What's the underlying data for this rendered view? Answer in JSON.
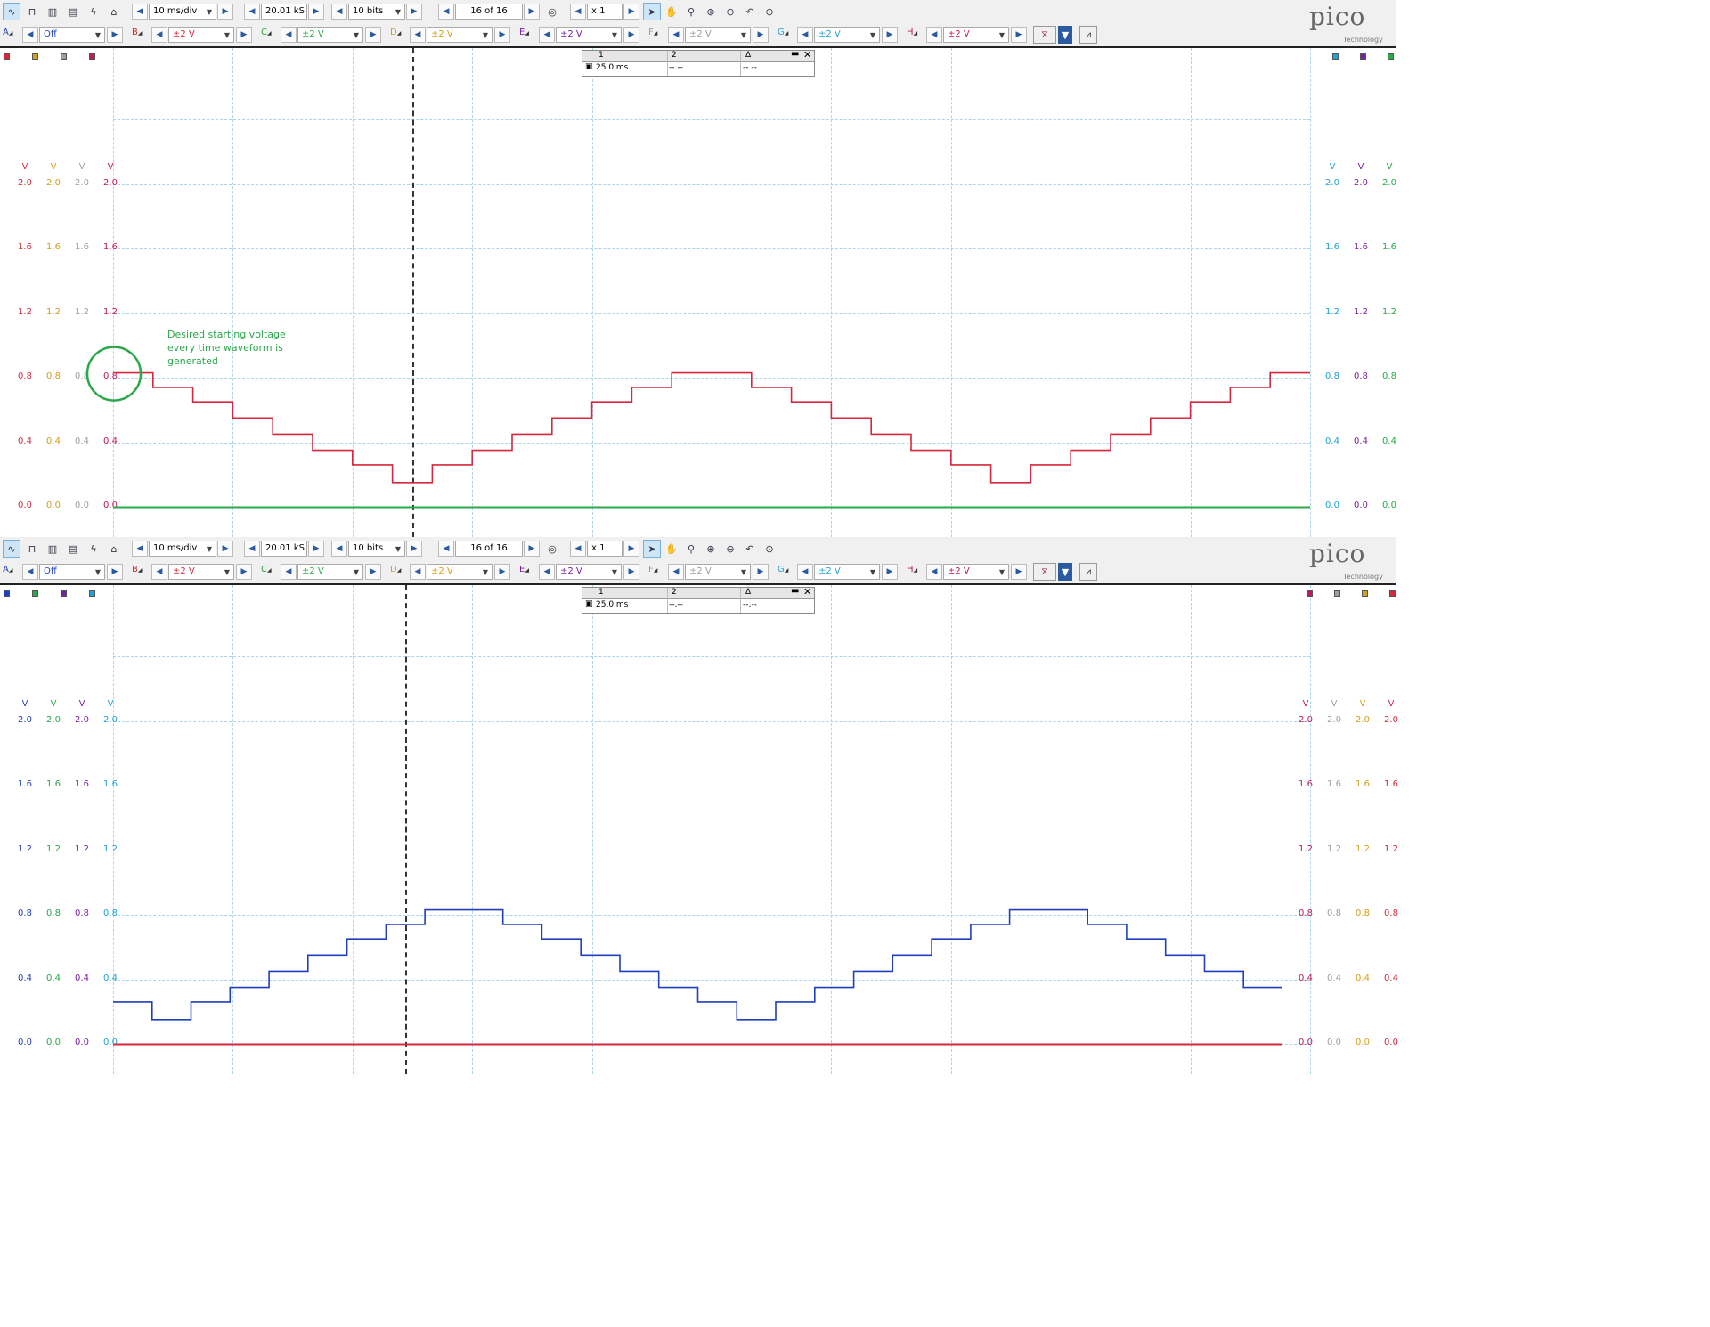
{
  "panels": [
    {
      "id": "top",
      "toolbar": {
        "timebase": "10 ms/div",
        "samples": "20.01 kS",
        "resolution": "10 bits",
        "buffer": "16 of 16",
        "zoom": "x 1"
      },
      "channels": [
        {
          "letter": "A",
          "range": "Off",
          "color": "#1f3fbf"
        },
        {
          "letter": "B",
          "range": "±2 V",
          "color": "#d6283c"
        },
        {
          "letter": "C",
          "range": "±2 V",
          "color": "#2aa84a"
        },
        {
          "letter": "D",
          "range": "±2 V",
          "color": "#d4a017"
        },
        {
          "letter": "E",
          "range": "±2 V",
          "color": "#7b1fa2"
        },
        {
          "letter": "F",
          "range": "±2 V",
          "color": "#9e9e9e"
        },
        {
          "letter": "G",
          "range": "±2 V",
          "color": "#1fa2d6"
        },
        {
          "letter": "H",
          "range": "±2 V",
          "color": "#c2185b"
        }
      ],
      "left_axes": [
        {
          "unit": "V",
          "color": "#d6283c",
          "ticks": [
            "2.0",
            "1.6",
            "1.2",
            "0.8",
            "0.4",
            "0.0"
          ]
        },
        {
          "unit": "V",
          "color": "#d4a017",
          "ticks": [
            "2.0",
            "1.6",
            "1.2",
            "0.8",
            "0.4",
            "0.0"
          ]
        },
        {
          "unit": "V",
          "color": "#9e9e9e",
          "ticks": [
            "2.0",
            "1.6",
            "1.2",
            "0.8",
            "0.4",
            "0.0"
          ]
        },
        {
          "unit": "V",
          "color": "#c2185b",
          "ticks": [
            "2.0",
            "1.6",
            "1.2",
            "0.8",
            "0.4",
            "0.0"
          ]
        }
      ],
      "right_axes": [
        {
          "unit": "V",
          "color": "#1fa2d6",
          "ticks": [
            "2.0",
            "1.6",
            "1.2",
            "0.8",
            "0.4",
            "0.0"
          ]
        },
        {
          "unit": "V",
          "color": "#7b1fa2",
          "ticks": [
            "2.0",
            "1.6",
            "1.2",
            "0.8",
            "0.4",
            "0.0"
          ]
        },
        {
          "unit": "V",
          "color": "#2aa84a",
          "ticks": [
            "2.0",
            "1.6",
            "1.2",
            "0.8",
            "0.4",
            "0.0"
          ]
        }
      ],
      "left_markers": [
        "#d6283c",
        "#d4a017",
        "#9e9e9e",
        "#c2185b"
      ],
      "right_markers": [
        "#1fa2d6",
        "#7b1fa2",
        "#2aa84a"
      ],
      "measurements": {
        "col1": "1",
        "col2": "2",
        "col3": "Δ",
        "row_value": "25.0 ms",
        "row_v2": "--.--",
        "row_delta": "--.--"
      },
      "annotation": [
        "Desired starting voltage",
        "every time waveform is",
        "generated"
      ],
      "annotation_color": "#2aa84a",
      "waveform": {
        "color": "#d6283c",
        "levels": [
          0.83,
          0.74,
          0.65,
          0.55,
          0.45,
          0.35,
          0.26,
          0.15,
          0.26,
          0.35,
          0.45,
          0.55,
          0.65,
          0.74,
          0.83,
          0.83,
          0.74,
          0.65,
          0.55,
          0.45,
          0.35,
          0.26,
          0.15,
          0.26,
          0.35,
          0.45,
          0.55,
          0.65,
          0.74,
          0.83
        ]
      },
      "baseline_color": "#2aa84a"
    },
    {
      "id": "bottom",
      "toolbar": {
        "timebase": "10 ms/div",
        "samples": "20.01 kS",
        "resolution": "10 bits",
        "buffer": "16 of 16",
        "zoom": "x 1"
      },
      "channels": [
        {
          "letter": "A",
          "range": "Off",
          "color": "#1f3fbf"
        },
        {
          "letter": "B",
          "range": "±2 V",
          "color": "#d6283c"
        },
        {
          "letter": "C",
          "range": "±2 V",
          "color": "#2aa84a"
        },
        {
          "letter": "D",
          "range": "±2 V",
          "color": "#d4a017"
        },
        {
          "letter": "E",
          "range": "±2 V",
          "color": "#7b1fa2"
        },
        {
          "letter": "F",
          "range": "±2 V",
          "color": "#9e9e9e"
        },
        {
          "letter": "G",
          "range": "±2 V",
          "color": "#1fa2d6"
        },
        {
          "letter": "H",
          "range": "±2 V",
          "color": "#c2185b"
        }
      ],
      "left_axes": [
        {
          "unit": "V",
          "color": "#1f3fbf",
          "ticks": [
            "2.0",
            "1.6",
            "1.2",
            "0.8",
            "0.4",
            "0.0"
          ]
        },
        {
          "unit": "V",
          "color": "#2aa84a",
          "ticks": [
            "2.0",
            "1.6",
            "1.2",
            "0.8",
            "0.4",
            "0.0"
          ]
        },
        {
          "unit": "V",
          "color": "#7b1fa2",
          "ticks": [
            "2.0",
            "1.6",
            "1.2",
            "0.8",
            "0.4",
            "0.0"
          ]
        },
        {
          "unit": "V",
          "color": "#1fa2d6",
          "ticks": [
            "2.0",
            "1.6",
            "1.2",
            "0.8",
            "0.4",
            "0.0"
          ]
        }
      ],
      "right_axes": [
        {
          "unit": "V",
          "color": "#c2185b",
          "ticks": [
            "2.0",
            "1.6",
            "1.2",
            "0.8",
            "0.4",
            "0.0"
          ]
        },
        {
          "unit": "V",
          "color": "#9e9e9e",
          "ticks": [
            "2.0",
            "1.6",
            "1.2",
            "0.8",
            "0.4",
            "0.0"
          ]
        },
        {
          "unit": "V",
          "color": "#d4a017",
          "ticks": [
            "2.0",
            "1.6",
            "1.2",
            "0.8",
            "0.4",
            "0.0"
          ]
        },
        {
          "unit": "V",
          "color": "#d6283c",
          "ticks": [
            "2.0",
            "1.6",
            "1.2",
            "0.8",
            "0.4",
            "0.0"
          ]
        }
      ],
      "left_markers": [
        "#1f3fbf",
        "#2aa84a",
        "#7b1fa2",
        "#1fa2d6"
      ],
      "right_markers": [
        "#c2185b",
        "#9e9e9e",
        "#d4a017",
        "#d6283c"
      ],
      "measurements": {
        "col1": "1",
        "col2": "2",
        "col3": "Δ",
        "row_value": "25.0 ms",
        "row_v2": "--.--",
        "row_delta": "--.--"
      },
      "waveform": {
        "color": "#1f3fbf",
        "levels": [
          0.26,
          0.15,
          0.26,
          0.35,
          0.45,
          0.55,
          0.65,
          0.74,
          0.83,
          0.83,
          0.74,
          0.65,
          0.55,
          0.45,
          0.35,
          0.26,
          0.15,
          0.26,
          0.35,
          0.45,
          0.55,
          0.65,
          0.74,
          0.83,
          0.83,
          0.74,
          0.65,
          0.55,
          0.45,
          0.35
        ]
      },
      "baseline_color": "#d6283c"
    }
  ],
  "logo": {
    "name": "pico",
    "sub": "Technology"
  }
}
